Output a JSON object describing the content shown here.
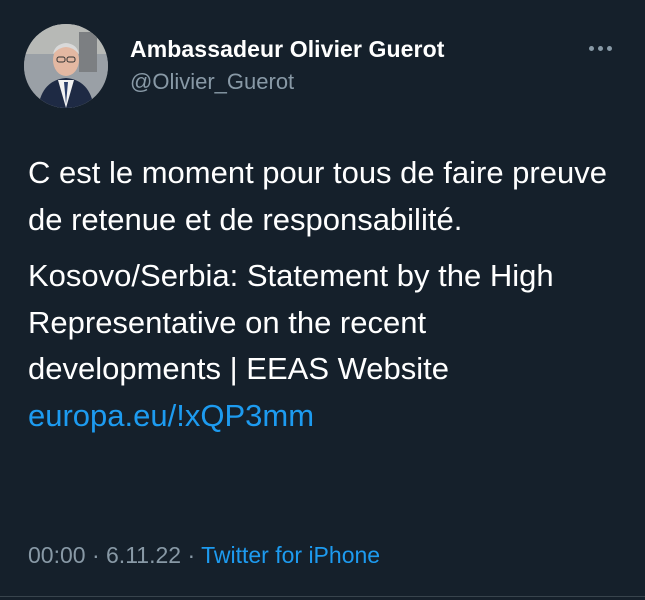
{
  "author": {
    "name": "Ambassadeur Olivier Guerot",
    "handle": "@Olivier_Guerot"
  },
  "tweet": {
    "text": "C est le moment pour tous de faire preuve de retenue et de responsabilité.",
    "link_title": "Kosovo/Serbia: Statement by the High Representative on the recent developments | EEAS Website",
    "link_url": "europa.eu/!xQP3mm"
  },
  "meta": {
    "time": "00:00",
    "separator": "·",
    "date": "6.11.22",
    "source": "Twitter for iPhone"
  },
  "colors": {
    "background": "#15202b",
    "text": "#ffffff",
    "muted": "#8899a6",
    "link": "#1d9bf0"
  },
  "icons": {
    "more": "more-horizontal-icon"
  }
}
